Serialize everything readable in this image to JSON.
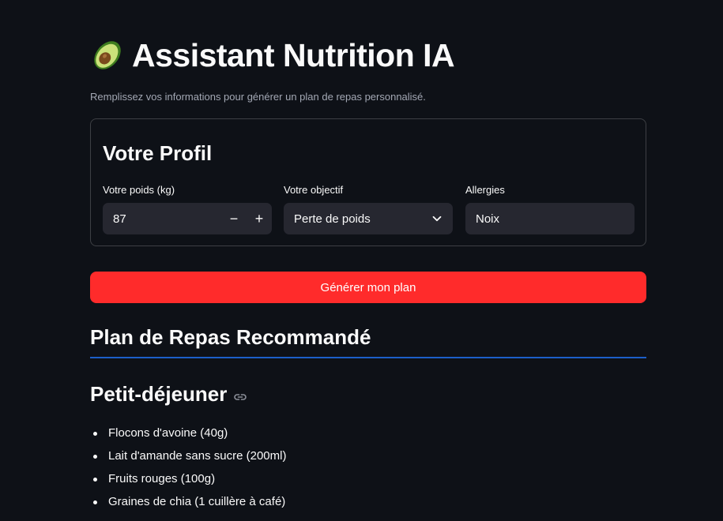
{
  "header": {
    "title": "Assistant Nutrition IA",
    "subtitle": "Remplissez vos informations pour générer un plan de repas personnalisé.",
    "icon": "avocado-icon"
  },
  "form": {
    "title": "Votre Profil",
    "weight": {
      "label": "Votre poids (kg)",
      "value": "87",
      "minus": "−",
      "plus": "+"
    },
    "goal": {
      "label": "Votre objectif",
      "value": "Perte de poids"
    },
    "allergies": {
      "label": "Allergies",
      "value": "Noix"
    }
  },
  "generate_button": "Générer mon plan",
  "colors": {
    "accent": "#ff2b2b",
    "rule": "#1c5fc9",
    "background": "#0e1117",
    "input_bg": "#262730"
  },
  "plan": {
    "title": "Plan de Repas Recommandé",
    "meal": {
      "title": "Petit-déjeuner",
      "items": [
        "Flocons d'avoine (40g)",
        "Lait d'amande sans sucre (200ml)",
        "Fruits rouges (100g)",
        "Graines de chia (1 cuillère à café)"
      ]
    }
  }
}
